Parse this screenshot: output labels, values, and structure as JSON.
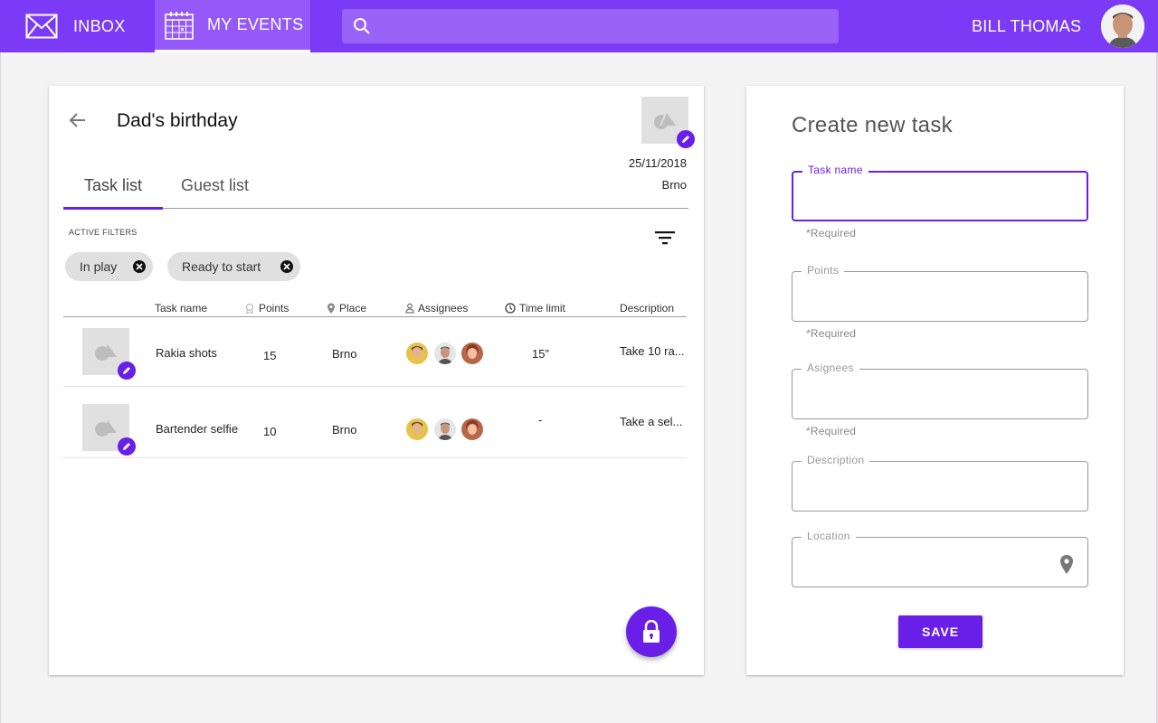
{
  "topbar": {
    "inbox_label": "INBOX",
    "events_label": "MY EVENTS",
    "search_placeholder": "",
    "user_name": "BILL THOMAS"
  },
  "event": {
    "title": "Dad's birthday",
    "date": "25/11/2018",
    "place": "Brno"
  },
  "tabs": [
    {
      "label": "Task list",
      "active": true
    },
    {
      "label": "Guest list",
      "active": false
    }
  ],
  "filters": {
    "label": "ACTIVE FILTERS",
    "chips": [
      "In play",
      "Ready to start"
    ]
  },
  "table": {
    "headers": [
      "Task name",
      "Points",
      "Place",
      "Assignees",
      "Time limit",
      "Description"
    ],
    "rows": [
      {
        "name": "Rakia shots",
        "points": "15",
        "place": "Brno",
        "time": "15”",
        "description": "Take 10 ra..."
      },
      {
        "name": "Bartender selfie",
        "points": "10",
        "place": "Brno",
        "time": "-",
        "description": "Take a sel..."
      }
    ]
  },
  "form": {
    "title": "Create new task",
    "fields": [
      {
        "label": "Task name",
        "helper": "*Required",
        "value": ""
      },
      {
        "label": "Points",
        "helper": "*Required",
        "value": ""
      },
      {
        "label": "Asignees",
        "helper": "*Required",
        "value": ""
      },
      {
        "label": "Description",
        "helper": "",
        "value": ""
      },
      {
        "label": "Location",
        "helper": "",
        "value": ""
      }
    ],
    "save_label": "SAVE"
  },
  "colors": {
    "brand": "#7b3af5",
    "accent": "#6a1fe8"
  },
  "icons": [
    "mail-icon",
    "calendar-icon",
    "search-icon",
    "back-arrow-icon",
    "image-placeholder-icon",
    "pencil-icon",
    "filter-icon",
    "close-circle-icon",
    "medal-icon",
    "location-pin-icon",
    "person-icon",
    "clock-icon",
    "lock-icon"
  ]
}
